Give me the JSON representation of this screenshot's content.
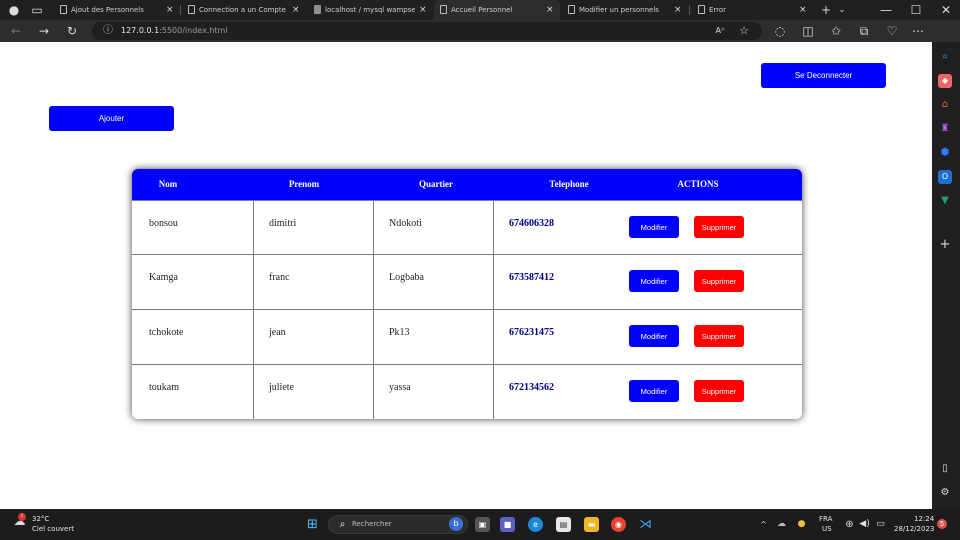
{
  "browser": {
    "tabs": [
      {
        "title": "Ajout des Personnels",
        "close": "×"
      },
      {
        "title": "Connection a un Compte",
        "close": "×"
      },
      {
        "title": "localhost / mysql wampse",
        "close": "×"
      },
      {
        "title": "Accueil Personnel",
        "close": "×"
      },
      {
        "title": "Modifier un personnels",
        "close": "×"
      },
      {
        "title": "Error",
        "close": "×"
      }
    ],
    "url_host": "127.0.0.1",
    "url_rest": ":5500/index.html",
    "read_aloud": "Aᴬ",
    "window_controls": {
      "minimize": "—",
      "maximize": "☐",
      "close": "✕"
    }
  },
  "page": {
    "logout_label": "Se Deconnecter",
    "add_label": "Ajouter",
    "table": {
      "headers": [
        "Nom",
        "Prenom",
        "Quartier",
        "Telephone",
        "ACTIONS"
      ],
      "rows": [
        {
          "nom": "bonsou",
          "prenom": "dimitri",
          "quartier": "Ndokoti",
          "telephone": "674606328",
          "modify": "Modifier",
          "delete": "Supprimer"
        },
        {
          "nom": "Kamga",
          "prenom": "franc",
          "quartier": "Logbaba",
          "telephone": "673587412",
          "modify": "Modifier",
          "delete": "Supprimer"
        },
        {
          "nom": "tchokote",
          "prenom": "jean",
          "quartier": "Pk13",
          "telephone": "676231475",
          "modify": "Modifier",
          "delete": "Supprimer"
        },
        {
          "nom": "toukam",
          "prenom": "juliete",
          "quartier": "yassa",
          "telephone": "672134562",
          "modify": "Modifier",
          "delete": "Supprimer"
        }
      ]
    }
  },
  "taskbar": {
    "weather_temp": "32°C",
    "weather_desc": "Ciel couvert",
    "search_placeholder": "Rechercher",
    "lang_top": "FRA",
    "lang_bottom": "US",
    "time": "12:24",
    "date": "28/12/2023",
    "notification_count": "5"
  },
  "colors": {
    "primary": "#0000ff",
    "danger": "#ff0000",
    "phone_text": "#00008b"
  }
}
